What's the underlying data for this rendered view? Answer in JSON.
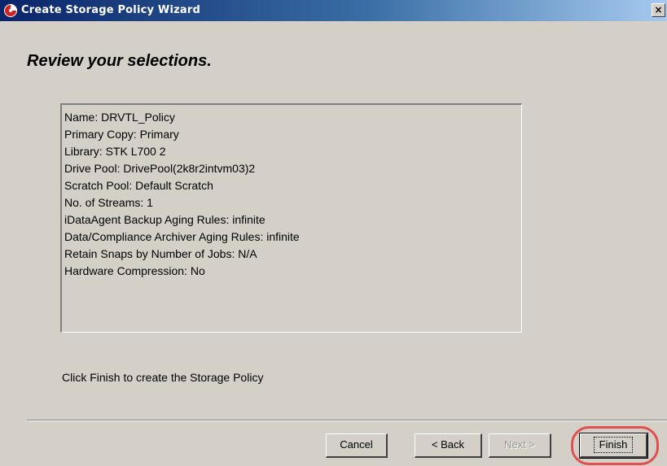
{
  "window": {
    "title": "Create Storage Policy Wizard",
    "close_label": "×"
  },
  "page": {
    "heading": "Review your selections.",
    "summary_lines": [
      "Name: DRVTL_Policy",
      "Primary Copy: Primary",
      "Library: STK L700 2",
      "Drive Pool: DrivePool(2k8r2intvm03)2",
      "Scratch Pool: Default Scratch",
      "No. of Streams: 1",
      "iDataAgent Backup Aging Rules: infinite",
      "Data/Compliance Archiver Aging Rules: infinite",
      "Retain Snaps by Number of Jobs:  N/A",
      "Hardware Compression: No"
    ],
    "hint": "Click Finish to create the Storage Policy"
  },
  "buttons": {
    "cancel": "Cancel",
    "back": "< Back",
    "next": "Next >",
    "finish": "Finish"
  },
  "colors": {
    "dialog_bg": "#d4d0c8",
    "title_gradient_start": "#0a246a",
    "highlight_ring": "#e05050"
  }
}
